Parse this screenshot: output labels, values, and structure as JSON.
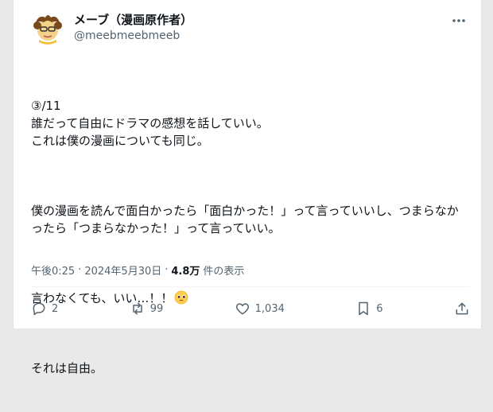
{
  "author": {
    "display_name": "メーブ（漫画原作者）",
    "handle": "@meebmeebmeeb"
  },
  "post": {
    "paragraphs": [
      "③/11\n誰だって自由にドラマの感想を話していい。\nこれは僕の漫画についても同じ。",
      "僕の漫画を読んで面白かったら「面白かった！」って言っていいし、つまらなかったら「つまらなかった！」って言っていい。",
      "言わなくても、いい…！！",
      "それは自由。"
    ]
  },
  "meta": {
    "time": "午後0:25",
    "sep1": "·",
    "date": "2024年5月30日",
    "sep2": "·",
    "views_count": "4.8万",
    "views_label": "件の表示"
  },
  "actions": {
    "reply_count": "2",
    "repost_count": "99",
    "like_count": "1,034",
    "bookmark_count": "6"
  },
  "icons": {
    "more": "more-horizontal-icon",
    "reply": "reply-icon",
    "repost": "repost-icon",
    "like": "heart-icon",
    "bookmark": "bookmark-icon",
    "share": "share-icon",
    "emoji": "pleading-face-emoji"
  },
  "colors": {
    "text": "#0f1419",
    "secondary": "#536471"
  }
}
